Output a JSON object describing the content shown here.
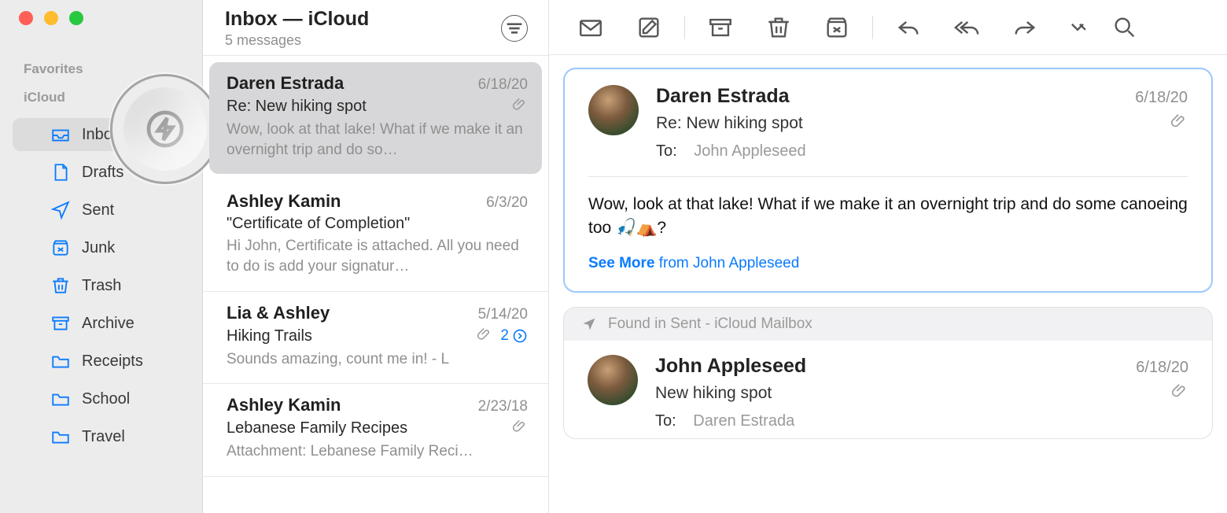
{
  "sidebar": {
    "sections": {
      "favorites_label": "Favorites",
      "icloud_label": "iCloud"
    },
    "folders": [
      {
        "id": "inbox",
        "label": "Inbox",
        "active": true
      },
      {
        "id": "drafts",
        "label": "Drafts"
      },
      {
        "id": "sent",
        "label": "Sent"
      },
      {
        "id": "junk",
        "label": "Junk"
      },
      {
        "id": "trash",
        "label": "Trash"
      },
      {
        "id": "archive",
        "label": "Archive"
      },
      {
        "id": "receipts",
        "label": "Receipts"
      },
      {
        "id": "school",
        "label": "School"
      },
      {
        "id": "travel",
        "label": "Travel"
      }
    ]
  },
  "listpane": {
    "title": "Inbox — iCloud",
    "subtitle": "5 messages",
    "items": [
      {
        "sender": "Daren Estrada",
        "date": "6/18/20",
        "subject": "Re: New hiking spot",
        "preview": "Wow, look at that lake! What if we make it an overnight trip and do so…",
        "attachment": true,
        "selected": true
      },
      {
        "sender": "Ashley Kamin",
        "date": "6/3/20",
        "subject": "\"Certificate of Completion\"",
        "preview": "Hi John, Certificate is attached. All you need to do is add your signatur…",
        "attachment": false
      },
      {
        "sender": "Lia & Ashley",
        "date": "5/14/20",
        "subject": "Hiking Trails",
        "preview": "Sounds amazing, count me in! - L",
        "attachment": true,
        "thread_count": 2
      },
      {
        "sender": "Ashley Kamin",
        "date": "2/23/18",
        "subject": "Lebanese Family Recipes",
        "preview": "Attachment: Lebanese Family Reci…",
        "attachment": true
      }
    ]
  },
  "reading": {
    "sender": "Daren Estrada",
    "date": "6/18/20",
    "subject": "Re: New hiking spot",
    "to_label": "To:",
    "to_value": "John Appleseed",
    "body": "Wow, look at that lake! What if we make it an overnight trip and do some canoeing too 🎣⛺?",
    "see_more_bold": "See More",
    "see_more_rest": " from John Appleseed",
    "related_bar": "Found in Sent - iCloud Mailbox",
    "related": {
      "sender": "John Appleseed",
      "date": "6/18/20",
      "subject": "New hiking spot",
      "to_label": "To:",
      "to_value": "Daren Estrada"
    }
  }
}
